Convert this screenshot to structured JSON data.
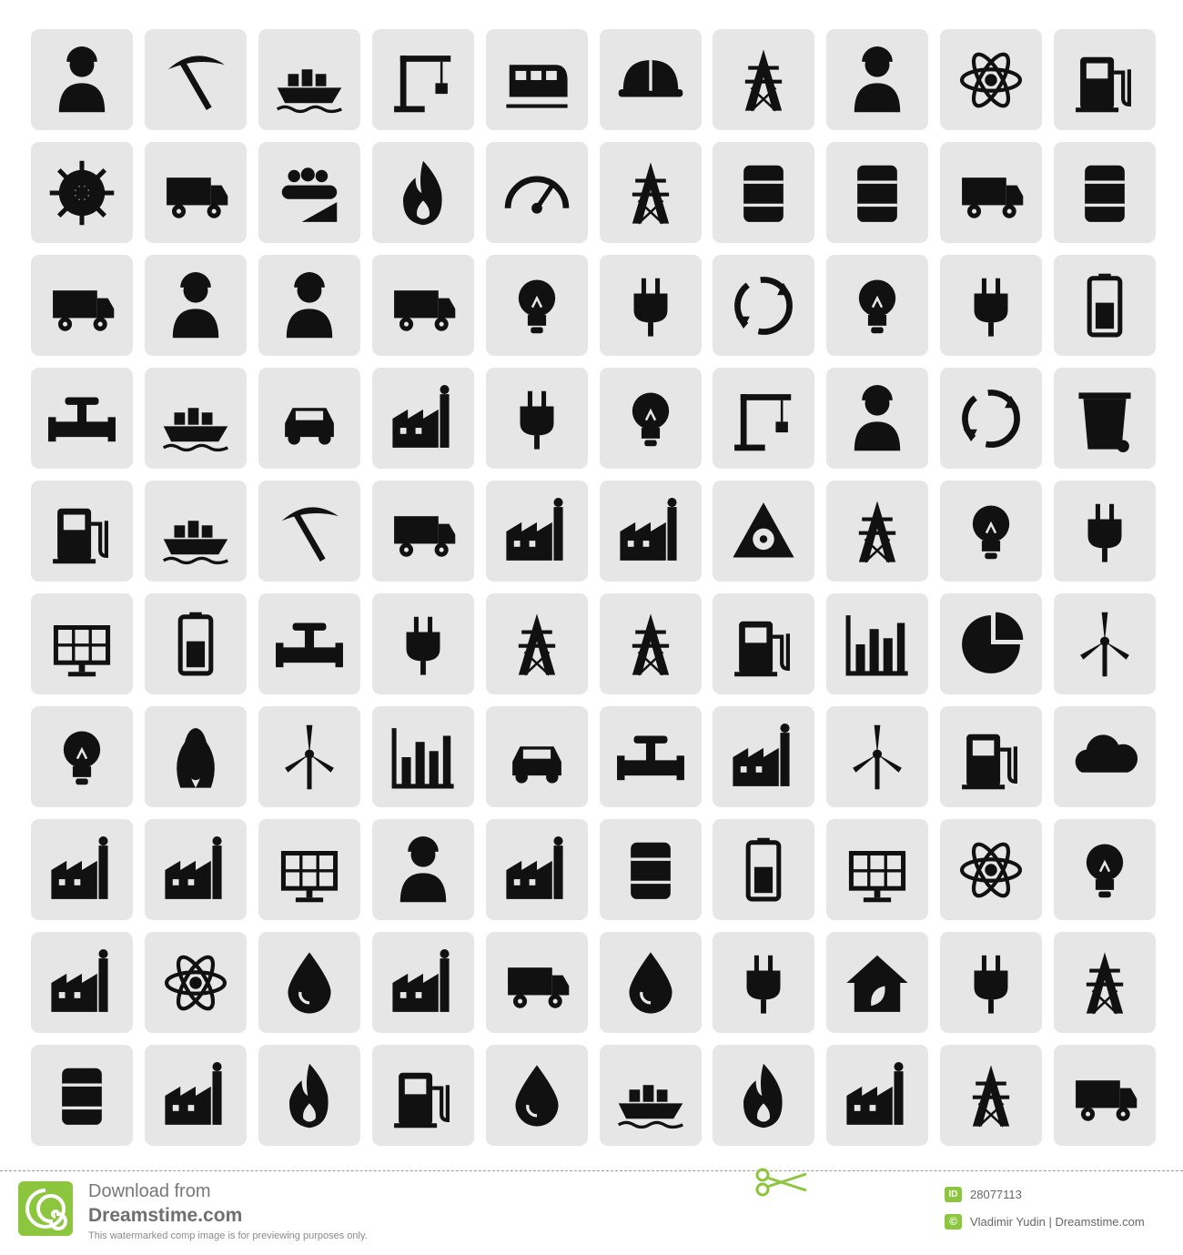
{
  "colors": {
    "tile_bg": "#e6e6e6",
    "icon": "#111111",
    "accent_green": "#8cc63e",
    "text_gray": "#6f6f6f"
  },
  "icons": [
    "miner-helmet-icon",
    "pickaxe-icon",
    "cargo-ship-icon",
    "container-crane-icon",
    "train-icon",
    "hard-hat-icon",
    "oil-rig-icon",
    "workers-icon",
    "atom-icon",
    "fuel-nozzle-icon",
    "cutting-wheel-icon",
    "dump-truck-icon",
    "conveyor-coal-icon",
    "coal-fire-icon",
    "speedometer-icon",
    "oil-gusher-icon",
    "oil-barrel-icon",
    "oil-can-icon",
    "tank-wagon-icon",
    "jerrycan-icon",
    "mine-cart-icon",
    "digging-worker-icon",
    "wheelbarrow-worker-icon",
    "recycling-truck-icon",
    "light-bulb-icon",
    "eco-plug-icon",
    "globe-arrow-icon",
    "bulb-circle-icon",
    "plug-icon",
    "battery-icon",
    "valve-icon",
    "ship-bow-icon",
    "electric-car-icon",
    "factory-icon",
    "power-socket-icon",
    "bulb-badge-icon",
    "crane-icon",
    "engineer-icon",
    "recycle-arrows-icon",
    "trash-bin-icon",
    "gas-pump-icon",
    "crane-ship-icon",
    "pickaxe-hand-icon",
    "coal-wagon-icon",
    "smoking-plant-icon",
    "industrial-plant-icon",
    "radiation-sign-icon",
    "cooling-towers-icon",
    "cfl-bulb-icon",
    "plug-cable-icon",
    "solar-panel-icon",
    "battery-vertical-icon",
    "water-tap-icon",
    "solar-plug-icon",
    "power-pylon-icon",
    "tower-crane-icon",
    "oil-pump-icon",
    "bar-chart-icon",
    "pie-chart-icon",
    "wind-turbines-icon",
    "idea-bulb-icon",
    "corn-icon",
    "wind-turbine-icon",
    "area-chart-icon",
    "fuel-car-icon",
    "pipe-tap-icon",
    "factory-smoke-icon",
    "wind-rotor-icon",
    "pumpjack-icon",
    "co2-cloud-icon",
    "factory-smoke-large-icon",
    "power-station-icon",
    "solar-array-icon",
    "miner-worker-icon",
    "refinery-icon",
    "fuel-canister-icon",
    "car-battery-icon",
    "solar-grid-icon",
    "atom-orbit-icon",
    "bulb-outline-icon",
    "nuclear-plant-icon",
    "atom-small-icon",
    "drop-outline-icon",
    "factory-chimney-icon",
    "tanker-truck-icon",
    "oil-drop-icon",
    "plug-curved-icon",
    "eco-house-icon",
    "wall-outlet-icon",
    "oil-tower-gusher-icon",
    "barrel-icon",
    "power-building-icon",
    "flame-icon",
    "fuel-dispenser-icon",
    "barrel-drop-icon",
    "tanker-ship-icon",
    "gas-flame-tower-icon",
    "chimney-plant-icon",
    "pylon-icon",
    "tank-trailer-icon"
  ],
  "footer": {
    "download_line1": "Download from",
    "download_line2": "Dreamstime.com",
    "watermark_note": "This watermarked comp image is for previewing purposes only.",
    "id_badge": "ID",
    "id_number": "28077113",
    "copyright_badge": "©",
    "credit": "Vladimir Yudin | Dreamstime.com"
  }
}
